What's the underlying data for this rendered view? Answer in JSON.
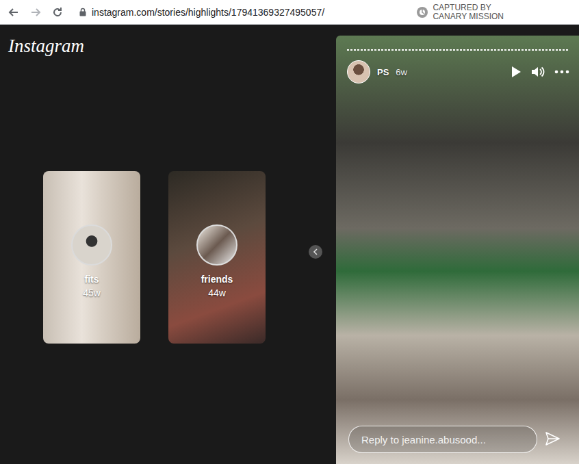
{
  "browser": {
    "url": "instagram.com/stories/highlights/17941369327495057/",
    "watermark": {
      "line1": "CAPTURED BY",
      "line2": "CANARY MISSION"
    }
  },
  "logo": "Instagram",
  "highlights": [
    {
      "title": "fits",
      "age": "45w"
    },
    {
      "title": "friends",
      "age": "44w"
    }
  ],
  "story": {
    "username": "PS",
    "age": "6w",
    "paused": true,
    "muted": false,
    "reply": {
      "placeholder": "Reply to jeanine.abusood..."
    }
  }
}
